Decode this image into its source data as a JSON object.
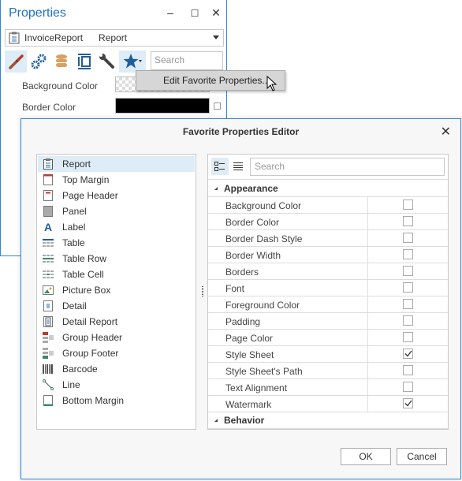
{
  "properties_panel": {
    "title": "Properties",
    "window_buttons": {
      "minimize": "–",
      "maximize": "☐",
      "close": "✕"
    },
    "object_selector": {
      "name": "InvoiceReport",
      "type": "Report"
    },
    "toolbar": {
      "buttons": [
        "brush-icon",
        "gears-icon",
        "database-icon",
        "size-icon",
        "wrench-icon",
        "star-icon"
      ],
      "search_placeholder": "Search"
    },
    "rows": [
      {
        "label": "Background Color",
        "value": "transparent"
      },
      {
        "label": "Border Color",
        "value": "#000000"
      }
    ]
  },
  "favorite_menu": {
    "item": "Edit Favorite Properties..."
  },
  "dialog": {
    "title": "Favorite Properties Editor",
    "close": "✕",
    "elements": [
      {
        "label": "Report",
        "icon": "report-icon",
        "selected": true
      },
      {
        "label": "Top Margin",
        "icon": "top-margin-icon"
      },
      {
        "label": "Page Header",
        "icon": "page-header-icon"
      },
      {
        "label": "Panel",
        "icon": "panel-icon"
      },
      {
        "label": "Label",
        "icon": "label-icon"
      },
      {
        "label": "Table",
        "icon": "table-icon"
      },
      {
        "label": "Table Row",
        "icon": "table-row-icon"
      },
      {
        "label": "Table Cell",
        "icon": "table-cell-icon"
      },
      {
        "label": "Picture Box",
        "icon": "picture-box-icon"
      },
      {
        "label": "Detail",
        "icon": "detail-icon"
      },
      {
        "label": "Detail Report",
        "icon": "detail-report-icon"
      },
      {
        "label": "Group Header",
        "icon": "group-header-icon"
      },
      {
        "label": "Group Footer",
        "icon": "group-footer-icon"
      },
      {
        "label": "Barcode",
        "icon": "barcode-icon"
      },
      {
        "label": "Line",
        "icon": "line-icon"
      },
      {
        "label": "Bottom Margin",
        "icon": "bottom-margin-icon"
      }
    ],
    "search_placeholder": "Search",
    "categories": [
      {
        "name": "Appearance",
        "properties": [
          {
            "name": "Background Color",
            "favorite": false
          },
          {
            "name": "Border Color",
            "favorite": false
          },
          {
            "name": "Border Dash Style",
            "favorite": false
          },
          {
            "name": "Border Width",
            "favorite": false
          },
          {
            "name": "Borders",
            "favorite": false
          },
          {
            "name": "Font",
            "favorite": false
          },
          {
            "name": "Foreground Color",
            "favorite": false
          },
          {
            "name": "Padding",
            "favorite": false
          },
          {
            "name": "Page Color",
            "favorite": false
          },
          {
            "name": "Style Sheet",
            "favorite": true
          },
          {
            "name": "Style Sheet's Path",
            "favorite": false
          },
          {
            "name": "Text Alignment",
            "favorite": false
          },
          {
            "name": "Watermark",
            "favorite": true
          }
        ]
      },
      {
        "name": "Behavior",
        "properties": []
      }
    ],
    "ok_label": "OK",
    "cancel_label": "Cancel"
  },
  "colors": {
    "accent": "#2b88d8",
    "title": "#1e73be",
    "selection": "#deecf8",
    "star": "#1f5e99"
  }
}
